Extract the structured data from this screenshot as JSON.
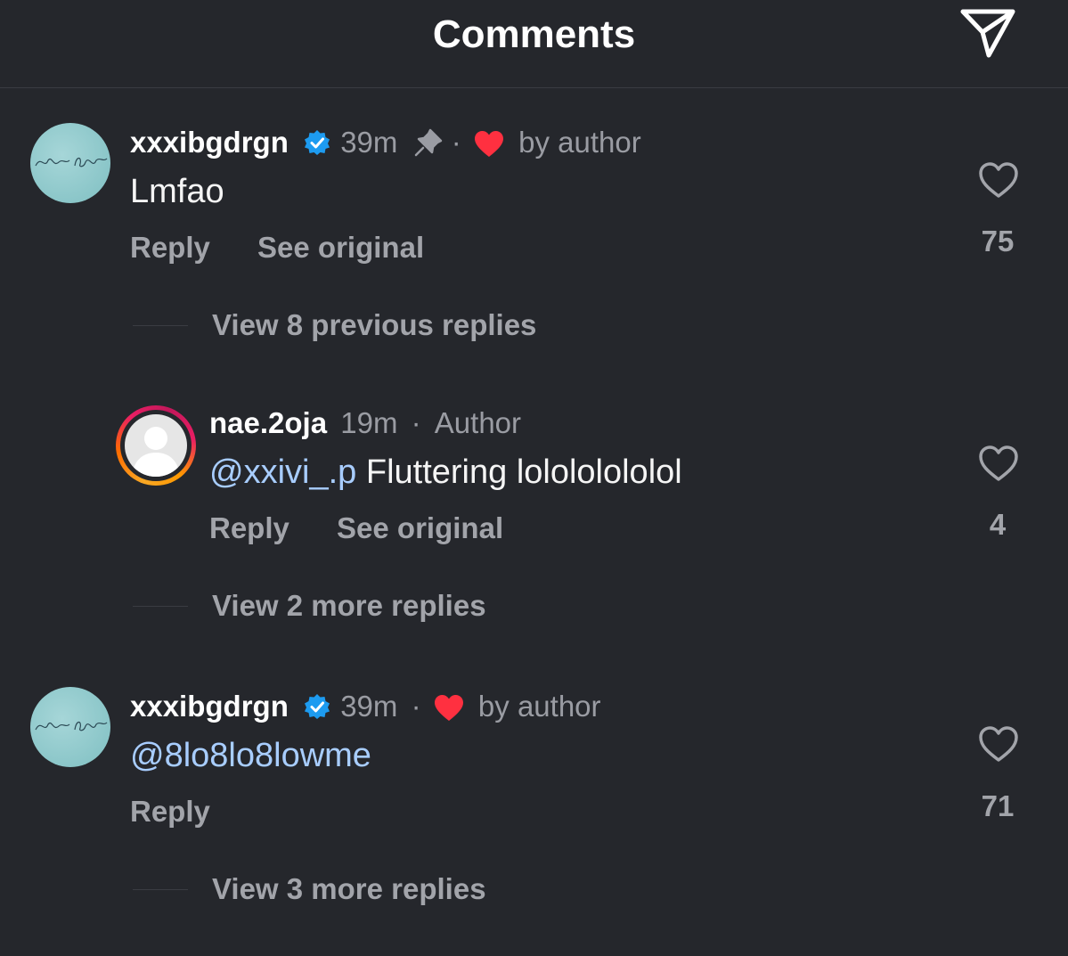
{
  "header": {
    "title": "Comments"
  },
  "comments": [
    {
      "username": "xxxibgdrgn",
      "time": "39m",
      "dot": "·",
      "liked_by": "by author",
      "text": "Lmfao",
      "reply_label": "Reply",
      "see_original_label": "See original",
      "likes": "75",
      "thread_label": "View 8 previous replies"
    },
    {
      "username": "nae.2oja",
      "time": "19m",
      "dot": "·",
      "author_tag": "Author",
      "mention": "@xxivi_.p",
      "text": " Fluttering lolololololol",
      "reply_label": "Reply",
      "see_original_label": "See original",
      "likes": "4",
      "thread_label": "View 2 more replies"
    },
    {
      "username": "xxxibgdrgn",
      "time": "39m",
      "dot": "·",
      "liked_by": "by author",
      "mention": "@8lo8lo8lowme",
      "reply_label": "Reply",
      "likes": "71",
      "thread_label": "View 3 more replies"
    }
  ],
  "colors": {
    "background": "#25272c",
    "mention": "#a8cdff",
    "verified": "#1d9bf0",
    "heart": "#ff3040"
  },
  "icons": [
    "send-icon",
    "verified-badge-icon",
    "pin-icon",
    "heart-icon",
    "heart-outline-icon"
  ]
}
